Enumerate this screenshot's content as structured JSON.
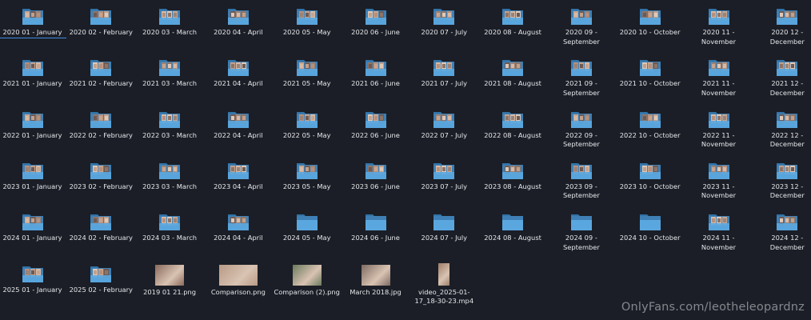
{
  "colors": {
    "background": "#1b1e26",
    "folder_back": "#3e80b6",
    "folder_front": "#5aa7df",
    "folder_tab": "#3173a8",
    "text": "#e6e8ec",
    "selection_underline": "#3d8be0"
  },
  "folders": [
    {
      "label": "2020 01 - January",
      "thumbs": true,
      "selected": true
    },
    {
      "label": "2020 02 - February",
      "thumbs": true
    },
    {
      "label": "2020 03 - March",
      "thumbs": true
    },
    {
      "label": "2020 04 - April",
      "thumbs": true
    },
    {
      "label": "2020 05 - May",
      "thumbs": true
    },
    {
      "label": "2020 06 - June",
      "thumbs": true
    },
    {
      "label": "2020 07 - July",
      "thumbs": true
    },
    {
      "label": "2020 08 - August",
      "thumbs": true
    },
    {
      "label": "2020 09 - September",
      "thumbs": true
    },
    {
      "label": "2020 10 - October",
      "thumbs": true
    },
    {
      "label": "2020 11 - November",
      "thumbs": true
    },
    {
      "label": "2020 12 - December",
      "thumbs": true
    },
    {
      "label": "2021 01 - January",
      "thumbs": true
    },
    {
      "label": "2021 02 - February",
      "thumbs": true
    },
    {
      "label": "2021 03 - March",
      "thumbs": true
    },
    {
      "label": "2021 04 - April",
      "thumbs": true
    },
    {
      "label": "2021 05 - May",
      "thumbs": true
    },
    {
      "label": "2021 06 - June",
      "thumbs": true
    },
    {
      "label": "2021 07 - July",
      "thumbs": true
    },
    {
      "label": "2021 08 - August",
      "thumbs": true
    },
    {
      "label": "2021 09 - September",
      "thumbs": true
    },
    {
      "label": "2021 10 - October",
      "thumbs": true
    },
    {
      "label": "2021 11 - November",
      "thumbs": true
    },
    {
      "label": "2021 12 - December",
      "thumbs": true
    },
    {
      "label": "2022 01 - January",
      "thumbs": true
    },
    {
      "label": "2022 02 - February",
      "thumbs": true
    },
    {
      "label": "2022 03 - March",
      "thumbs": true
    },
    {
      "label": "2022 04 - April",
      "thumbs": true
    },
    {
      "label": "2022 05 - May",
      "thumbs": true
    },
    {
      "label": "2022 06 - June",
      "thumbs": true
    },
    {
      "label": "2022 07 - July",
      "thumbs": true
    },
    {
      "label": "2022 08 - August",
      "thumbs": true
    },
    {
      "label": "2022 09 - September",
      "thumbs": true
    },
    {
      "label": "2022 10 - October",
      "thumbs": true
    },
    {
      "label": "2022 11 - November",
      "thumbs": true
    },
    {
      "label": "2022 12 - December",
      "thumbs": true
    },
    {
      "label": "2023 01 - January",
      "thumbs": true
    },
    {
      "label": "2023 02 - February",
      "thumbs": true
    },
    {
      "label": "2023 03 - March",
      "thumbs": true
    },
    {
      "label": "2023 04 - April",
      "thumbs": true
    },
    {
      "label": "2023 05 - May",
      "thumbs": true
    },
    {
      "label": "2023 06 - June",
      "thumbs": true
    },
    {
      "label": "2023 07 - July",
      "thumbs": true
    },
    {
      "label": "2023 08 - August",
      "thumbs": true
    },
    {
      "label": "2023 09 - September",
      "thumbs": true
    },
    {
      "label": "2023 10 - October",
      "thumbs": true
    },
    {
      "label": "2023 11 - November",
      "thumbs": true
    },
    {
      "label": "2023 12 - December",
      "thumbs": true
    },
    {
      "label": "2024 01 - January",
      "thumbs": true
    },
    {
      "label": "2024 02 - February",
      "thumbs": true
    },
    {
      "label": "2024 03 - March",
      "thumbs": true
    },
    {
      "label": "2024 04 - April",
      "thumbs": true
    },
    {
      "label": "2024 05 - May",
      "thumbs": false
    },
    {
      "label": "2024 06 - June",
      "thumbs": false
    },
    {
      "label": "2024 07 - July",
      "thumbs": false
    },
    {
      "label": "2024 08 - August",
      "thumbs": false
    },
    {
      "label": "2024 09 - September",
      "thumbs": false
    },
    {
      "label": "2024 10 - October",
      "thumbs": false
    },
    {
      "label": "2024 11 - November",
      "thumbs": true
    },
    {
      "label": "2024 12 - December",
      "thumbs": true
    },
    {
      "label": "2025 01 - January",
      "thumbs": true
    },
    {
      "label": "2025 02 - February",
      "thumbs": true
    }
  ],
  "files": [
    {
      "label": "2019 01 21.png",
      "kind": "image",
      "shape": "landscape",
      "tone": "#8a6a5c"
    },
    {
      "label": "Comparison.png",
      "kind": "image",
      "shape": "wide",
      "tone": "#b89a86"
    },
    {
      "label": "Comparison (2).png",
      "kind": "image",
      "shape": "landscape",
      "tone": "#6b7a5e"
    },
    {
      "label": "March 2018.jpg",
      "kind": "image",
      "shape": "landscape",
      "tone": "#7d6a63"
    },
    {
      "label": "video_2025-01-17_18-30-23.mp4",
      "kind": "video",
      "shape": "portrait",
      "tone": "#9c7d68"
    }
  ],
  "watermark": "OnlyFans.com/leotheleopardnz"
}
